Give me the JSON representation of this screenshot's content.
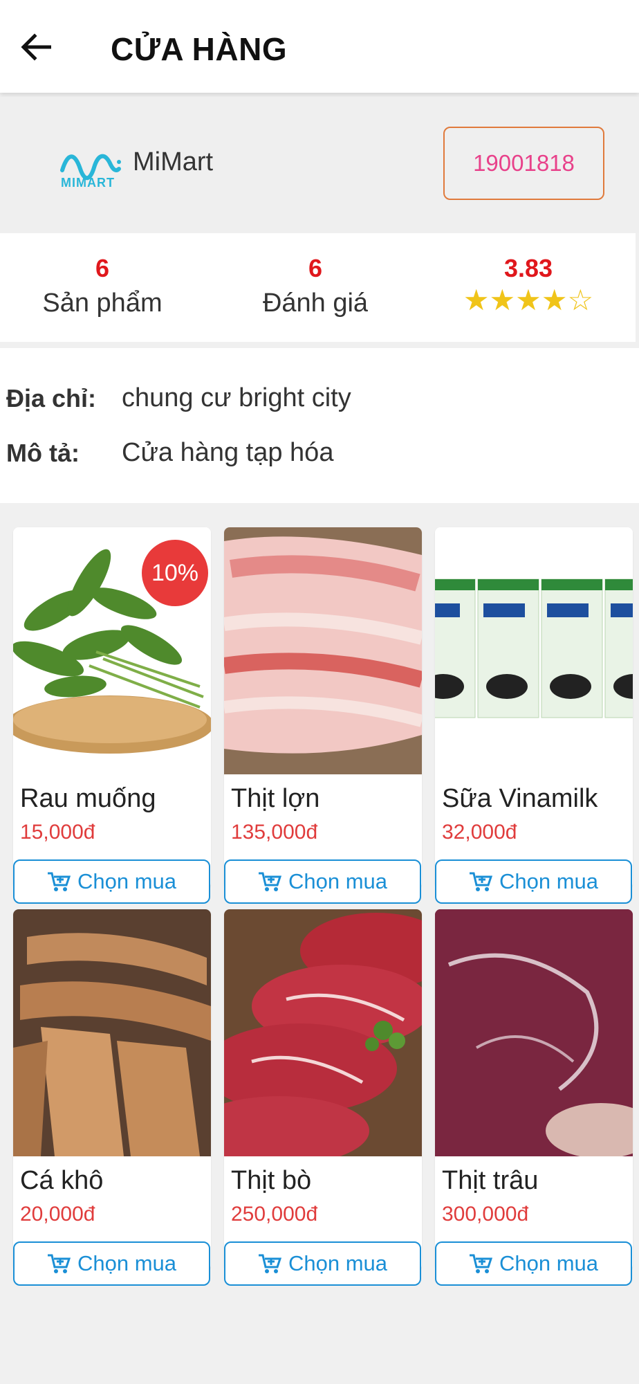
{
  "appbar": {
    "title": "CỬA HÀNG"
  },
  "store": {
    "logo_text": "MIMART",
    "name": "MiMart",
    "phone": "19001818",
    "brand_color": "#29b6d8"
  },
  "stats": {
    "products_count": "6",
    "products_label": "Sản phẩm",
    "reviews_count": "6",
    "reviews_label": "Đánh giá",
    "rating": "3.83",
    "rating_value": 3.83,
    "rating_max": 5
  },
  "info": {
    "address_label": "Địa chỉ:",
    "address_value": "chung cư bright city",
    "description_label": "Mô tả:",
    "description_value": "Cửa hàng tạp hóa"
  },
  "products": [
    {
      "name": "Rau muống",
      "price": "15,000đ",
      "discount": "10%",
      "buy_label": "Chọn mua"
    },
    {
      "name": "Thịt lợn",
      "price": "135,000đ",
      "buy_label": "Chọn mua"
    },
    {
      "name": "Sữa Vinamilk",
      "price": "32,000đ",
      "buy_label": "Chọn mua"
    },
    {
      "name": "Cá khô",
      "price": "20,000đ",
      "buy_label": "Chọn mua"
    },
    {
      "name": "Thịt bò",
      "price": "250,000đ",
      "buy_label": "Chọn mua"
    },
    {
      "name": "Thịt trâu",
      "price": "300,000đ",
      "buy_label": "Chọn mua"
    }
  ],
  "colors": {
    "accent": "#1a8fd6",
    "price": "#e03c3c",
    "stat_value": "#e0171c",
    "phone_text": "#e8418a",
    "phone_border": "#e07a3c",
    "star": "#f0c419"
  }
}
